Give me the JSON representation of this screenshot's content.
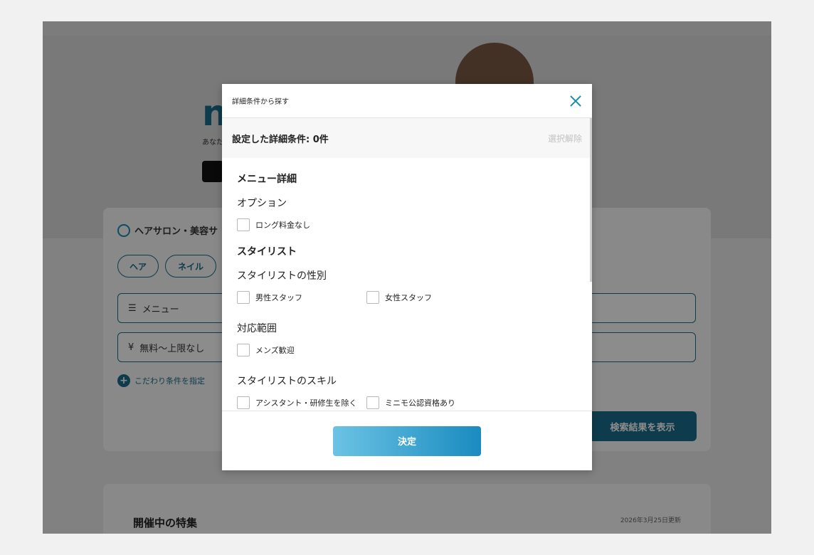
{
  "background": {
    "logo": "n",
    "tagline": "あなた",
    "search": {
      "title": "ヘアサロン・美容サ",
      "pills": [
        "ヘア",
        "ネイル"
      ],
      "menu_field": "メニュー",
      "price_field": "無料〜上限なし",
      "kodawari_link": "こだわり条件を指定",
      "result_button": "検索結果を表示"
    },
    "feature": {
      "title": "開催中の特集",
      "updated": "2026年3月25日更新"
    }
  },
  "modal": {
    "title": "詳細条件から探す",
    "summary_label": "設定した詳細条件: 0件",
    "clear_label": "選択解除",
    "sections": {
      "menu": {
        "title": "メニュー詳細",
        "option_group": "オプション",
        "option_items": [
          "ロング料金なし"
        ]
      },
      "stylist": {
        "title": "スタイリスト",
        "gender_group": "スタイリストの性別",
        "gender_items": [
          "男性スタッフ",
          "女性スタッフ"
        ],
        "range_group": "対応範囲",
        "range_items": [
          "メンズ歓迎"
        ],
        "skill_group": "スタイリストのスキル",
        "skill_items": [
          "アシスタント・研修生を除く",
          "ミニモ公認資格あり"
        ]
      }
    },
    "submit_label": "決定"
  },
  "colors": {
    "brand": "#1a6d8a",
    "accent": "#1a8bb5",
    "overlay": "rgba(0,0,0,0.45)"
  }
}
